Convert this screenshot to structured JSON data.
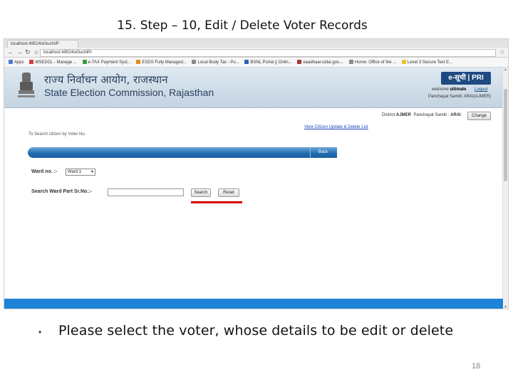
{
  "slide": {
    "title": "15. Step – 10, Edit / Delete Voter Records",
    "bullet_text": "Please select the voter, whose details to be edit or delete",
    "page_number": "18"
  },
  "browser": {
    "tab_title": "localhost:49524/eSuchi/P",
    "url": "localhost:49524/eSuchiPr",
    "bookmarks": [
      "Apps",
      "MSEDCL - Manage ...",
      "e-TAX Payment Syst...",
      "ESDS Fully Managed...",
      "Local Body Tax - Pu...",
      "BSNL Portal || Onlin...",
      "eaadhaar.uidai.gov....",
      "Home: Office of the ...",
      "Level 3 Secure Text E..."
    ]
  },
  "header": {
    "hindi_title": "राज्य निर्वाचन आयोग, राजस्थान",
    "english_title": "State Election Commission, Rajasthan",
    "logo_text": "e-सूची | PRI",
    "welcome_label": "welcome",
    "welcome_user": "ultimate",
    "logout": "Logout",
    "panchayat_line": "Panchayat Samiti: ARAI(AJMER)"
  },
  "page": {
    "district_label": "District:",
    "district_value": "AJMER",
    "samiti_label": "Panchayat Samiti :",
    "samiti_value": "ARAI",
    "change_button": "Change",
    "view_link": "View Citizen Update & Delete List",
    "search_caption": "To Search citizen by Voter No.",
    "back_button": "Back",
    "ward_label": "Ward no. :-",
    "ward_selected": "Ward 1",
    "serial_label": "Search Ward Part Sr.No.:-",
    "serial_value": "",
    "search_button": "Search",
    "reset_button": "Reset"
  },
  "colors": {
    "highlight_underline": "#d40000",
    "banner_text": "#2a3e5c",
    "blue_bar": "#1f6bb0",
    "bottom_stripe": "#1e83d6"
  }
}
